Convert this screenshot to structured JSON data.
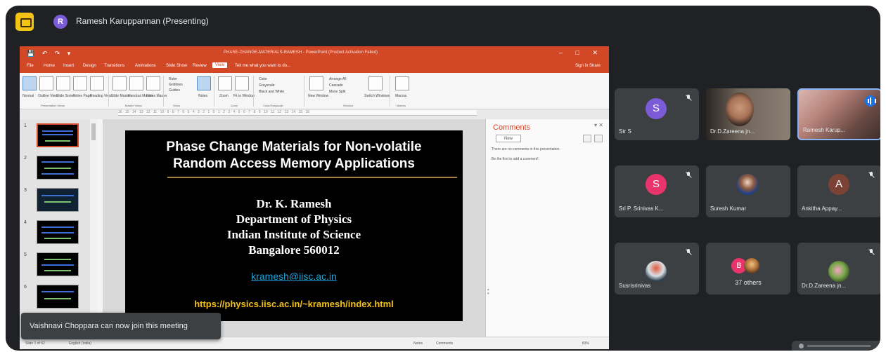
{
  "meeting": {
    "presenter_initial": "R",
    "presenter_title": "Ramesh Karuppannan (Presenting)"
  },
  "powerpoint": {
    "quick_access": "💾 ↶ ↷ ▾",
    "doc_title": "PHASE-CHANGE-MATERIALS-RAMESH - PowerPoint (Product Activation Failed)",
    "window_controls": "– □ ✕",
    "tabs": [
      "File",
      "Home",
      "Insert",
      "Design",
      "Transitions",
      "Animations",
      "Slide Show",
      "Review",
      "View"
    ],
    "active_tab": "View",
    "tell_me": "Tell me what you want to do...",
    "signin": "Sign in   Share",
    "ribbon": {
      "views": [
        "Normal",
        "Outline View",
        "Slide Sorter",
        "Notes Page",
        "Reading View"
      ],
      "masters": [
        "Slide Master",
        "Handout Master",
        "Notes Master"
      ],
      "show": [
        "Ruler",
        "Gridlines",
        "Guides"
      ],
      "notes": "Notes",
      "zoom": [
        "Zoom",
        "Fit to Window"
      ],
      "color": [
        "Color",
        "Grayscale",
        "Black and White"
      ],
      "window": [
        "New Window",
        "Arrange All",
        "Cascade",
        "Move Split",
        "Switch Windows"
      ],
      "macros": "Macros",
      "groups": [
        "Presentation Views",
        "Master Views",
        "Show",
        "Zoom",
        "Color/Grayscale",
        "Window",
        "Macros"
      ]
    },
    "ruler": "16 · 15 · 14 · 13 · 12 · 11 · 10 · 9 · 8 · 7 · 6 · 5 · 4 · 3 · 2 · 1 · 0 · 1 · 2 · 3 · 4 · 5 · 6 · 7 · 8 · 9 · 10 · 11 · 12 · 13 · 14 · 15 · 16",
    "slide_numbers": [
      "1",
      "2",
      "3",
      "4",
      "5",
      "6"
    ],
    "slide": {
      "title_line1": "Phase Change Materials for Non-volatile",
      "title_line2": "Random Access Memory Applications",
      "author": "Dr. K. Ramesh",
      "department": "Department of Physics",
      "institute": "Indian Institute of Science",
      "city": "Bangalore 560012",
      "email": "kramesh@iisc.ac.in",
      "url": "https://physics.iisc.ac.in/~kramesh/index.html"
    },
    "comments": {
      "title": "Comments",
      "new_label": "New",
      "empty_text": "There are no comments in this presentation.",
      "first_text": "Be the first to add a comment!"
    },
    "status": {
      "slide_count": "Slide 1 of 62",
      "language": "English (India)",
      "notes": "Notes",
      "comments": "Comments",
      "zoom": "83%"
    }
  },
  "toast": "Vaishnavi Choppara can now join this meeting",
  "participants": [
    {
      "name": "Str S",
      "initial": "S",
      "color": "#7b5bd8"
    },
    {
      "name": "Dr.D.Zareena jn..."
    },
    {
      "name": "Ramesh Karup..."
    },
    {
      "name": "Sri P. Srinivas K...",
      "initial": "S",
      "color": "#e8336b"
    },
    {
      "name": "Suresh Kumar"
    },
    {
      "name": "Ankitha Appay...",
      "initial": "A",
      "color": "#7a4336"
    },
    {
      "name": "Susrisrinivas"
    },
    {
      "name": "37 others",
      "initial": "B",
      "color": "#e8336b"
    },
    {
      "name": "Dr.D.Zareena jn..."
    }
  ]
}
